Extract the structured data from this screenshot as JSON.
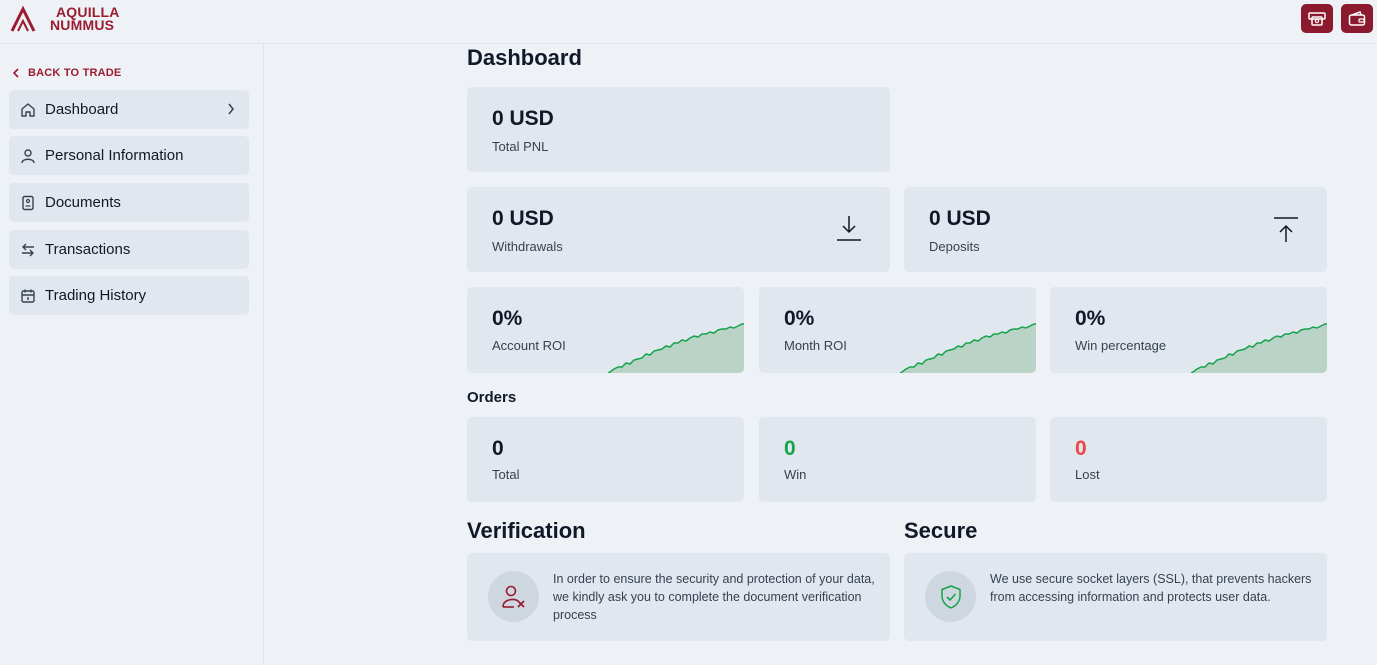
{
  "brand": {
    "line1": "AQUILLA",
    "line2": "NUMMUS",
    "color": "#9b1c31"
  },
  "topbar": {
    "buttons": [
      {
        "icon": "cashier-icon"
      },
      {
        "icon": "wallet-icon"
      }
    ]
  },
  "sidebar": {
    "back_label": "BACK TO TRADE",
    "items": [
      {
        "label": "Dashboard",
        "icon": "home-icon",
        "active": true
      },
      {
        "label": "Personal Information",
        "icon": "user-icon"
      },
      {
        "label": "Documents",
        "icon": "document-icon"
      },
      {
        "label": "Transactions",
        "icon": "transfer-icon"
      },
      {
        "label": "Trading History",
        "icon": "calendar-icon"
      }
    ]
  },
  "main": {
    "title": "Dashboard",
    "total_pnl": {
      "value": "0 USD",
      "label": "Total PNL"
    },
    "withdrawals": {
      "value": "0 USD",
      "label": "Withdrawals",
      "icon": "download-icon"
    },
    "deposits": {
      "value": "0 USD",
      "label": "Deposits",
      "icon": "upload-icon"
    },
    "stats": [
      {
        "value": "0%",
        "label": "Account ROI"
      },
      {
        "value": "0%",
        "label": "Month ROI"
      },
      {
        "value": "0%",
        "label": "Win percentage"
      }
    ],
    "orders_title": "Orders",
    "orders": [
      {
        "value": "0",
        "label": "Total",
        "color": "#111827"
      },
      {
        "value": "0",
        "label": "Win",
        "color": "#16a34a"
      },
      {
        "value": "0",
        "label": "Lost",
        "color": "#ef4444"
      }
    ],
    "verification": {
      "title": "Verification",
      "text": "In order to ensure the security and protection of your data, we kindly ask you to complete the document verification process",
      "icon": "user-x-icon"
    },
    "secure": {
      "title": "Secure",
      "text": "We use secure socket layers (SSL), that prevents hackers from accessing information and protects user data.",
      "icon": "shield-check-icon"
    }
  },
  "colors": {
    "accent": "#8b1a2e",
    "card_bg": "#e1e7ef",
    "page_bg": "#eef2f7",
    "chart_green": "#16a34a",
    "chart_fill": "#b9d4c6"
  }
}
